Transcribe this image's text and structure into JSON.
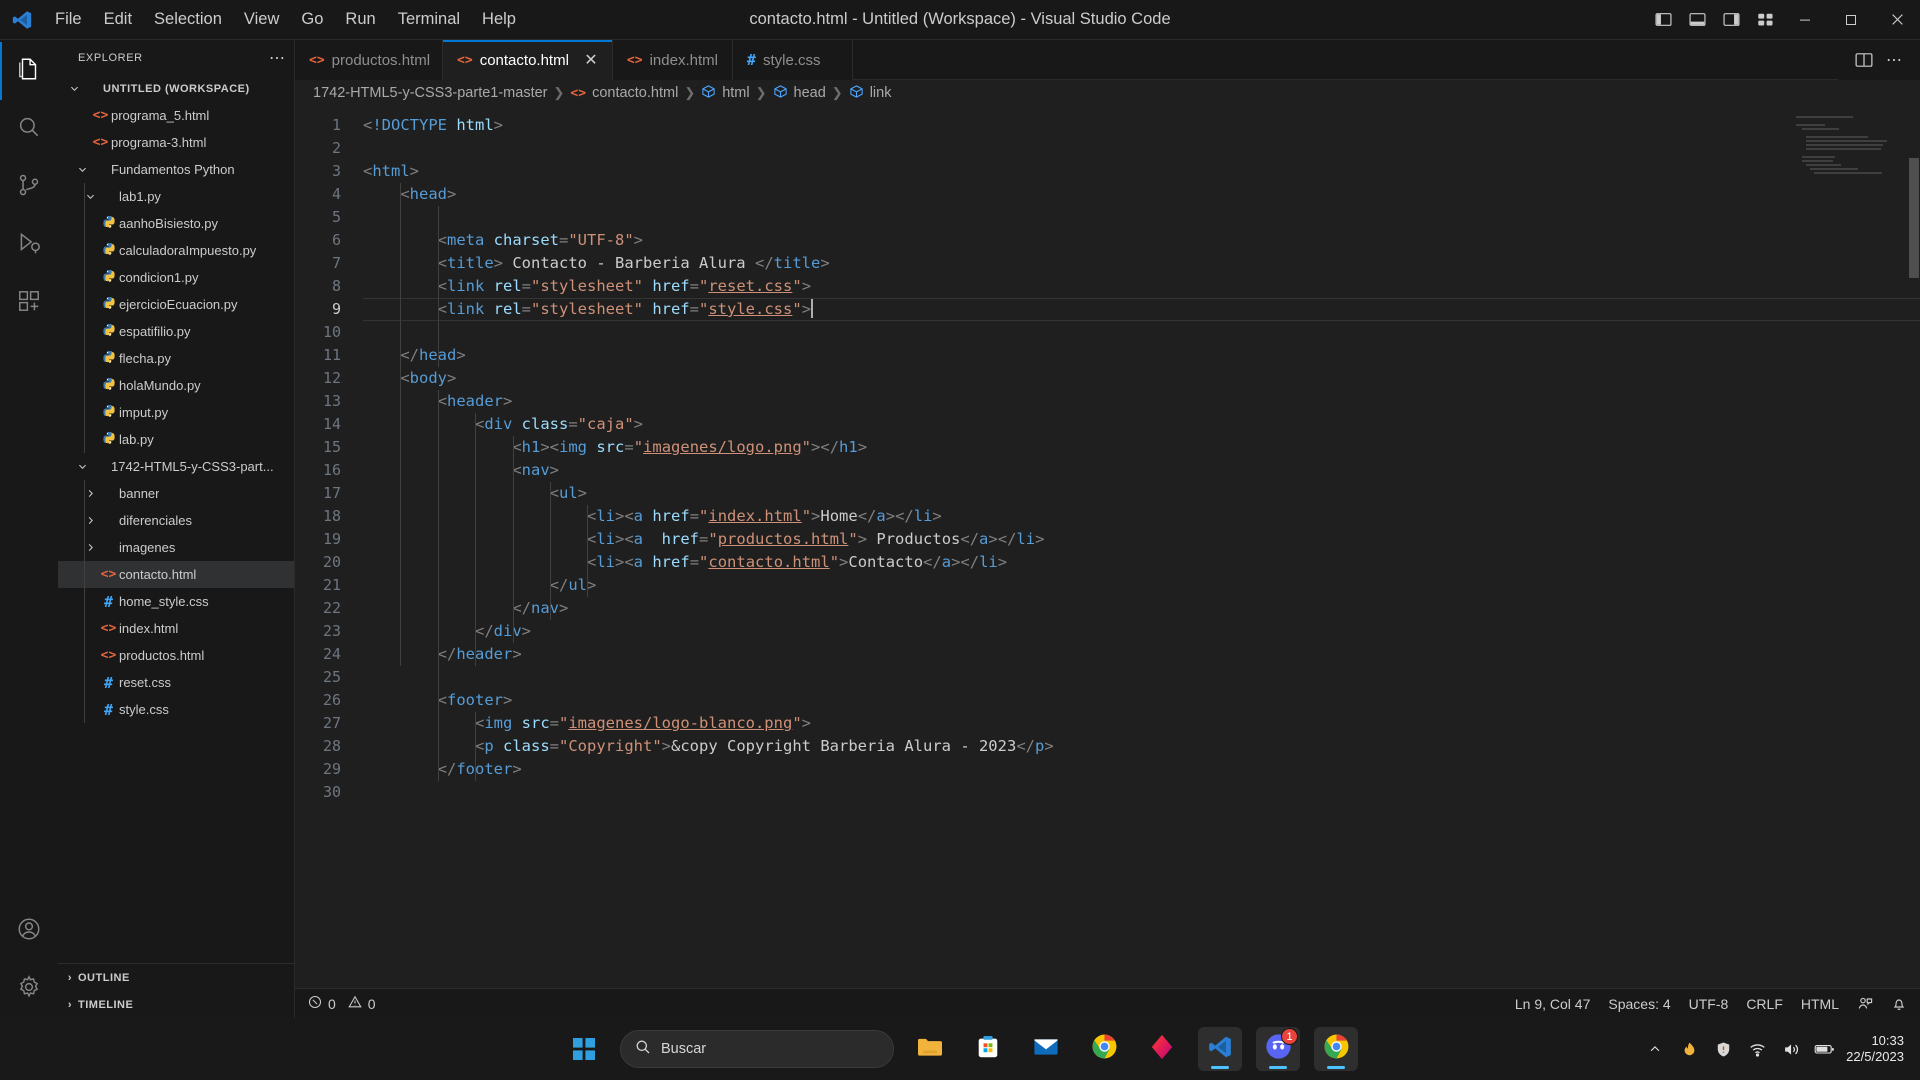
{
  "titlebar": {
    "logo_icon": "vscode-logo-icon",
    "menus": [
      "File",
      "Edit",
      "Selection",
      "View",
      "Go",
      "Run",
      "Terminal",
      "Help"
    ],
    "window_title": "contacto.html - Untitled (Workspace) - Visual Studio Code",
    "layout_icons": [
      "toggle-primary-sidebar-icon",
      "toggle-panel-icon",
      "toggle-secondary-sidebar-icon",
      "customize-layout-icon"
    ],
    "window_controls": [
      "minimize",
      "maximize",
      "close"
    ]
  },
  "activitybar": {
    "items": [
      {
        "name": "explorer",
        "icon": "files-icon",
        "active": true
      },
      {
        "name": "search",
        "icon": "search-icon",
        "active": false
      },
      {
        "name": "source-control",
        "icon": "source-control-icon",
        "active": false
      },
      {
        "name": "run-and-debug",
        "icon": "run-debug-icon",
        "active": false
      },
      {
        "name": "extensions",
        "icon": "extensions-icon",
        "active": false
      }
    ],
    "bottom": [
      {
        "name": "accounts",
        "icon": "account-icon"
      },
      {
        "name": "manage",
        "icon": "gear-icon"
      }
    ]
  },
  "sidebar": {
    "title": "EXPLORER",
    "more_actions_icon": "ellipsis-icon",
    "tree": [
      {
        "label": "UNTITLED (WORKSPACE)",
        "icon": "none",
        "twisty": "down",
        "depth": 0,
        "root": true
      },
      {
        "label": "programa_5.html",
        "icon": "html-icon",
        "twisty": "none",
        "depth": 1
      },
      {
        "label": "programa-3.html",
        "icon": "html-icon",
        "twisty": "none",
        "depth": 1
      },
      {
        "label": "Fundamentos Python",
        "icon": "none",
        "twisty": "down",
        "depth": 1
      },
      {
        "label": "lab1.py",
        "icon": "none",
        "twisty": "down",
        "depth": 2
      },
      {
        "label": "aanhoBisiesto.py",
        "icon": "python-icon",
        "twisty": "none",
        "depth": 2
      },
      {
        "label": "calculadoraImpuesto.py",
        "icon": "python-icon",
        "twisty": "none",
        "depth": 2
      },
      {
        "label": "condicion1.py",
        "icon": "python-icon",
        "twisty": "none",
        "depth": 2
      },
      {
        "label": "ejercicioEcuacion.py",
        "icon": "python-icon",
        "twisty": "none",
        "depth": 2
      },
      {
        "label": "espatifilio.py",
        "icon": "python-icon",
        "twisty": "none",
        "depth": 2
      },
      {
        "label": "flecha.py",
        "icon": "python-icon",
        "twisty": "none",
        "depth": 2
      },
      {
        "label": "holaMundo.py",
        "icon": "python-icon",
        "twisty": "none",
        "depth": 2
      },
      {
        "label": "imput.py",
        "icon": "python-icon",
        "twisty": "none",
        "depth": 2
      },
      {
        "label": "lab.py",
        "icon": "python-icon",
        "twisty": "none",
        "depth": 2
      },
      {
        "label": "1742-HTML5-y-CSS3-part...",
        "icon": "none",
        "twisty": "down",
        "depth": 1
      },
      {
        "label": "banner",
        "icon": "none",
        "twisty": "right",
        "depth": 2
      },
      {
        "label": "diferenciales",
        "icon": "none",
        "twisty": "right",
        "depth": 2
      },
      {
        "label": "imagenes",
        "icon": "none",
        "twisty": "right",
        "depth": 2
      },
      {
        "label": "contacto.html",
        "icon": "html-icon",
        "twisty": "none",
        "depth": 2,
        "selected": true
      },
      {
        "label": "home_style.css",
        "icon": "css-icon",
        "twisty": "none",
        "depth": 2
      },
      {
        "label": "index.html",
        "icon": "html-icon",
        "twisty": "none",
        "depth": 2
      },
      {
        "label": "productos.html",
        "icon": "html-icon",
        "twisty": "none",
        "depth": 2
      },
      {
        "label": "reset.css",
        "icon": "css-icon",
        "twisty": "none",
        "depth": 2
      },
      {
        "label": "style.css",
        "icon": "css-icon",
        "twisty": "none",
        "depth": 2
      }
    ],
    "panels": [
      {
        "label": "OUTLINE",
        "twisty": "right"
      },
      {
        "label": "TIMELINE",
        "twisty": "right"
      }
    ]
  },
  "editor": {
    "tabs": [
      {
        "label": "productos.html",
        "icon": "html-icon",
        "active": false,
        "closable": false
      },
      {
        "label": "contacto.html",
        "icon": "html-icon",
        "active": true,
        "closable": true,
        "close_icon": "close-icon"
      },
      {
        "label": "index.html",
        "icon": "html-icon",
        "active": false,
        "closable": false
      },
      {
        "label": "style.css",
        "icon": "css-icon",
        "active": false,
        "closable": false
      }
    ],
    "tab_actions": [
      "split-editor-icon",
      "more-actions-icon"
    ],
    "breadcrumb": [
      {
        "label": "1742-HTML5-y-CSS3-parte1-master",
        "icon": "none"
      },
      {
        "label": "contacto.html",
        "icon": "html-icon"
      },
      {
        "label": "html",
        "icon": "symbol-icon"
      },
      {
        "label": "head",
        "icon": "symbol-icon"
      },
      {
        "label": "link",
        "icon": "symbol-icon"
      }
    ],
    "line_numbers": [
      1,
      2,
      3,
      4,
      5,
      6,
      7,
      8,
      9,
      10,
      11,
      12,
      13,
      14,
      15,
      16,
      17,
      18,
      19,
      20,
      21,
      22,
      23,
      24,
      25,
      26,
      27,
      28,
      29,
      30
    ],
    "current_line": 9,
    "lines": [
      {
        "n": 1,
        "text": "<!DOCTYPE html>"
      },
      {
        "n": 2,
        "text": ""
      },
      {
        "n": 3,
        "text": "<html>"
      },
      {
        "n": 4,
        "text": "    <head>"
      },
      {
        "n": 5,
        "text": ""
      },
      {
        "n": 6,
        "text": "        <meta charset=\"UTF-8\">"
      },
      {
        "n": 7,
        "text": "        <title> Contacto - Barberia Alura </title>"
      },
      {
        "n": 8,
        "text": "        <link rel=\"stylesheet\" href=\"reset.css\">"
      },
      {
        "n": 9,
        "text": "        <link rel=\"stylesheet\" href=\"style.css\">"
      },
      {
        "n": 10,
        "text": ""
      },
      {
        "n": 11,
        "text": "    </head>"
      },
      {
        "n": 12,
        "text": "    <body>"
      },
      {
        "n": 13,
        "text": "        <header>"
      },
      {
        "n": 14,
        "text": "            <div class=\"caja\">"
      },
      {
        "n": 15,
        "text": "                <h1><img src=\"imagenes/logo.png\"></h1>"
      },
      {
        "n": 16,
        "text": "                <nav>"
      },
      {
        "n": 17,
        "text": "                    <ul>"
      },
      {
        "n": 18,
        "text": "                        <li><a href=\"index.html\">Home</a></li>"
      },
      {
        "n": 19,
        "text": "                        <li><a  href=\"productos.html\"> Productos</a></li>"
      },
      {
        "n": 20,
        "text": "                        <li><a href=\"contacto.html\">Contacto</a></li>"
      },
      {
        "n": 21,
        "text": "                    </ul>"
      },
      {
        "n": 22,
        "text": "                </nav>"
      },
      {
        "n": 23,
        "text": "            </div>"
      },
      {
        "n": 24,
        "text": "        </header>"
      },
      {
        "n": 25,
        "text": ""
      },
      {
        "n": 26,
        "text": "        <footer>"
      },
      {
        "n": 27,
        "text": "            <img src=\"imagenes/logo-blanco.png\">"
      },
      {
        "n": 28,
        "text": "            <p class=\"Copyright\">&copy Copyright Barberia Alura - 2023</p>"
      },
      {
        "n": 29,
        "text": "        </footer>"
      },
      {
        "n": 30,
        "text": ""
      }
    ]
  },
  "statusbar": {
    "errors_icon": "error-icon",
    "errors": "0",
    "warnings_icon": "warning-icon",
    "warnings": "0",
    "cursor_position": "Ln 9, Col 47",
    "indentation": "Spaces: 4",
    "encoding": "UTF-8",
    "eol": "CRLF",
    "language": "HTML",
    "feedback_icon": "feedback-icon",
    "bell_icon": "bell-icon"
  },
  "taskbar": {
    "start_icon": "windows-start-icon",
    "search_placeholder": "Buscar",
    "search_icon": "search-icon",
    "apps": [
      {
        "name": "file-explorer",
        "icon": "folder-icon",
        "running": false
      },
      {
        "name": "microsoft-store",
        "icon": "store-icon",
        "running": false
      },
      {
        "name": "mail",
        "icon": "mail-icon",
        "running": false
      },
      {
        "name": "google-chrome",
        "icon": "chrome-icon",
        "running": false
      },
      {
        "name": "adobe-app",
        "icon": "diamond-icon",
        "running": false
      },
      {
        "name": "visual-studio-code",
        "icon": "vscode-icon",
        "running": true
      },
      {
        "name": "discord",
        "icon": "discord-icon",
        "running": true,
        "badge": "1"
      },
      {
        "name": "google-chrome-2",
        "icon": "chrome-icon",
        "running": true
      }
    ],
    "tray": [
      "chevron-up-icon",
      "flame-icon",
      "shield-warning-icon",
      "wifi-icon",
      "volume-icon",
      "battery-icon"
    ],
    "clock_time": "10:33",
    "clock_date": "22/5/2023"
  }
}
